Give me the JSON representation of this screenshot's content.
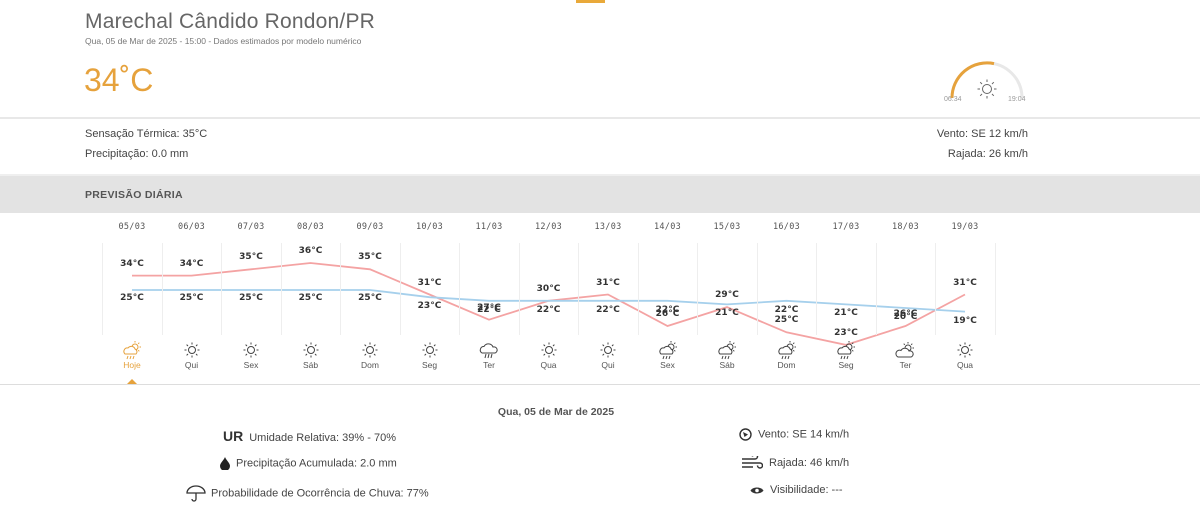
{
  "location": {
    "city": "Marechal Cândido Rondon/PR",
    "subtitle": "Qua, 05 de Mar de 2025 - 15:00 - Dados estimados por modelo numérico",
    "current_temp": "34˚C",
    "sunrise": "06:34",
    "sunset": "19:04"
  },
  "current": {
    "feels_like": "Sensação Térmica: 35°C",
    "precipitation": "Precipitação: 0.0 mm",
    "wind": "Vento: SE 12 km/h",
    "gust": "Rajada: 26 km/h"
  },
  "forecast": {
    "section_title": "PREVISÃO DIÁRIA",
    "days": [
      {
        "date": "05/03",
        "label": "Hoje",
        "max": "34°C",
        "min": "25°C",
        "icon": "sun-rain-icon",
        "today": true
      },
      {
        "date": "06/03",
        "label": "Qui",
        "max": "34°C",
        "min": "25°C",
        "icon": "sun-icon"
      },
      {
        "date": "07/03",
        "label": "Sex",
        "max": "35°C",
        "min": "25°C",
        "icon": "sun-icon"
      },
      {
        "date": "08/03",
        "label": "Sáb",
        "max": "36°C",
        "min": "25°C",
        "icon": "sun-icon"
      },
      {
        "date": "09/03",
        "label": "Dom",
        "max": "35°C",
        "min": "25°C",
        "icon": "sun-icon"
      },
      {
        "date": "10/03",
        "label": "Seg",
        "max": "31°C",
        "min": "23°C",
        "icon": "sun-icon"
      },
      {
        "date": "11/03",
        "label": "Ter",
        "max": "27°C",
        "min": "22°C",
        "icon": "rain-cloud-icon"
      },
      {
        "date": "12/03",
        "label": "Qua",
        "max": "30°C",
        "min": "22°C",
        "icon": "sun-icon"
      },
      {
        "date": "13/03",
        "label": "Qui",
        "max": "31°C",
        "min": "22°C",
        "icon": "sun-icon"
      },
      {
        "date": "14/03",
        "label": "Sex",
        "max": "26°C",
        "min": "22°C",
        "icon": "sun-rain-icon"
      },
      {
        "date": "15/03",
        "label": "Sáb",
        "max": "29°C",
        "min": "21°C",
        "icon": "sun-rain-icon"
      },
      {
        "date": "16/03",
        "label": "Dom",
        "max": "25°C",
        "min": "22°C",
        "icon": "sun-rain-icon"
      },
      {
        "date": "17/03",
        "label": "Seg",
        "max": "23°C",
        "min": "21°C",
        "icon": "sun-rain-icon"
      },
      {
        "date": "18/03",
        "label": "Ter",
        "max": "26°C",
        "min": "20°C",
        "icon": "sun-cloud-icon"
      },
      {
        "date": "19/03",
        "label": "Qua",
        "max": "31°C",
        "min": "19°C",
        "icon": "sun-icon"
      }
    ]
  },
  "chart_data": {
    "type": "line",
    "categories": [
      "05/03",
      "06/03",
      "07/03",
      "08/03",
      "09/03",
      "10/03",
      "11/03",
      "12/03",
      "13/03",
      "14/03",
      "15/03",
      "16/03",
      "17/03",
      "18/03",
      "19/03"
    ],
    "series": [
      {
        "values": [
          34,
          34,
          35,
          36,
          35,
          31,
          27,
          30,
          31,
          26,
          29,
          25,
          23,
          26,
          31
        ],
        "color": "#f4a3a3"
      },
      {
        "values": [
          25,
          25,
          25,
          25,
          25,
          23,
          22,
          22,
          22,
          22,
          21,
          22,
          21,
          20,
          19
        ],
        "color": "#a6d0ec"
      }
    ]
  },
  "details": {
    "date": "Qua, 05 de Mar de 2025",
    "ur_badge": "UR",
    "humidity": "Umidade Relativa: 39% - 70%",
    "precip_acc": "Precipitação Acumulada: 2.0 mm",
    "rain_prob": "Probabilidade de Ocorrência de Chuva: 77%",
    "wind": "Vento: SE 14 km/h",
    "gust": "Rajada: 46 km/h",
    "visibility": "Visibilidade: ---"
  },
  "colors": {
    "accent": "#e6a23c",
    "max_line": "#f4a3a3",
    "min_line": "#a6d0ec"
  }
}
